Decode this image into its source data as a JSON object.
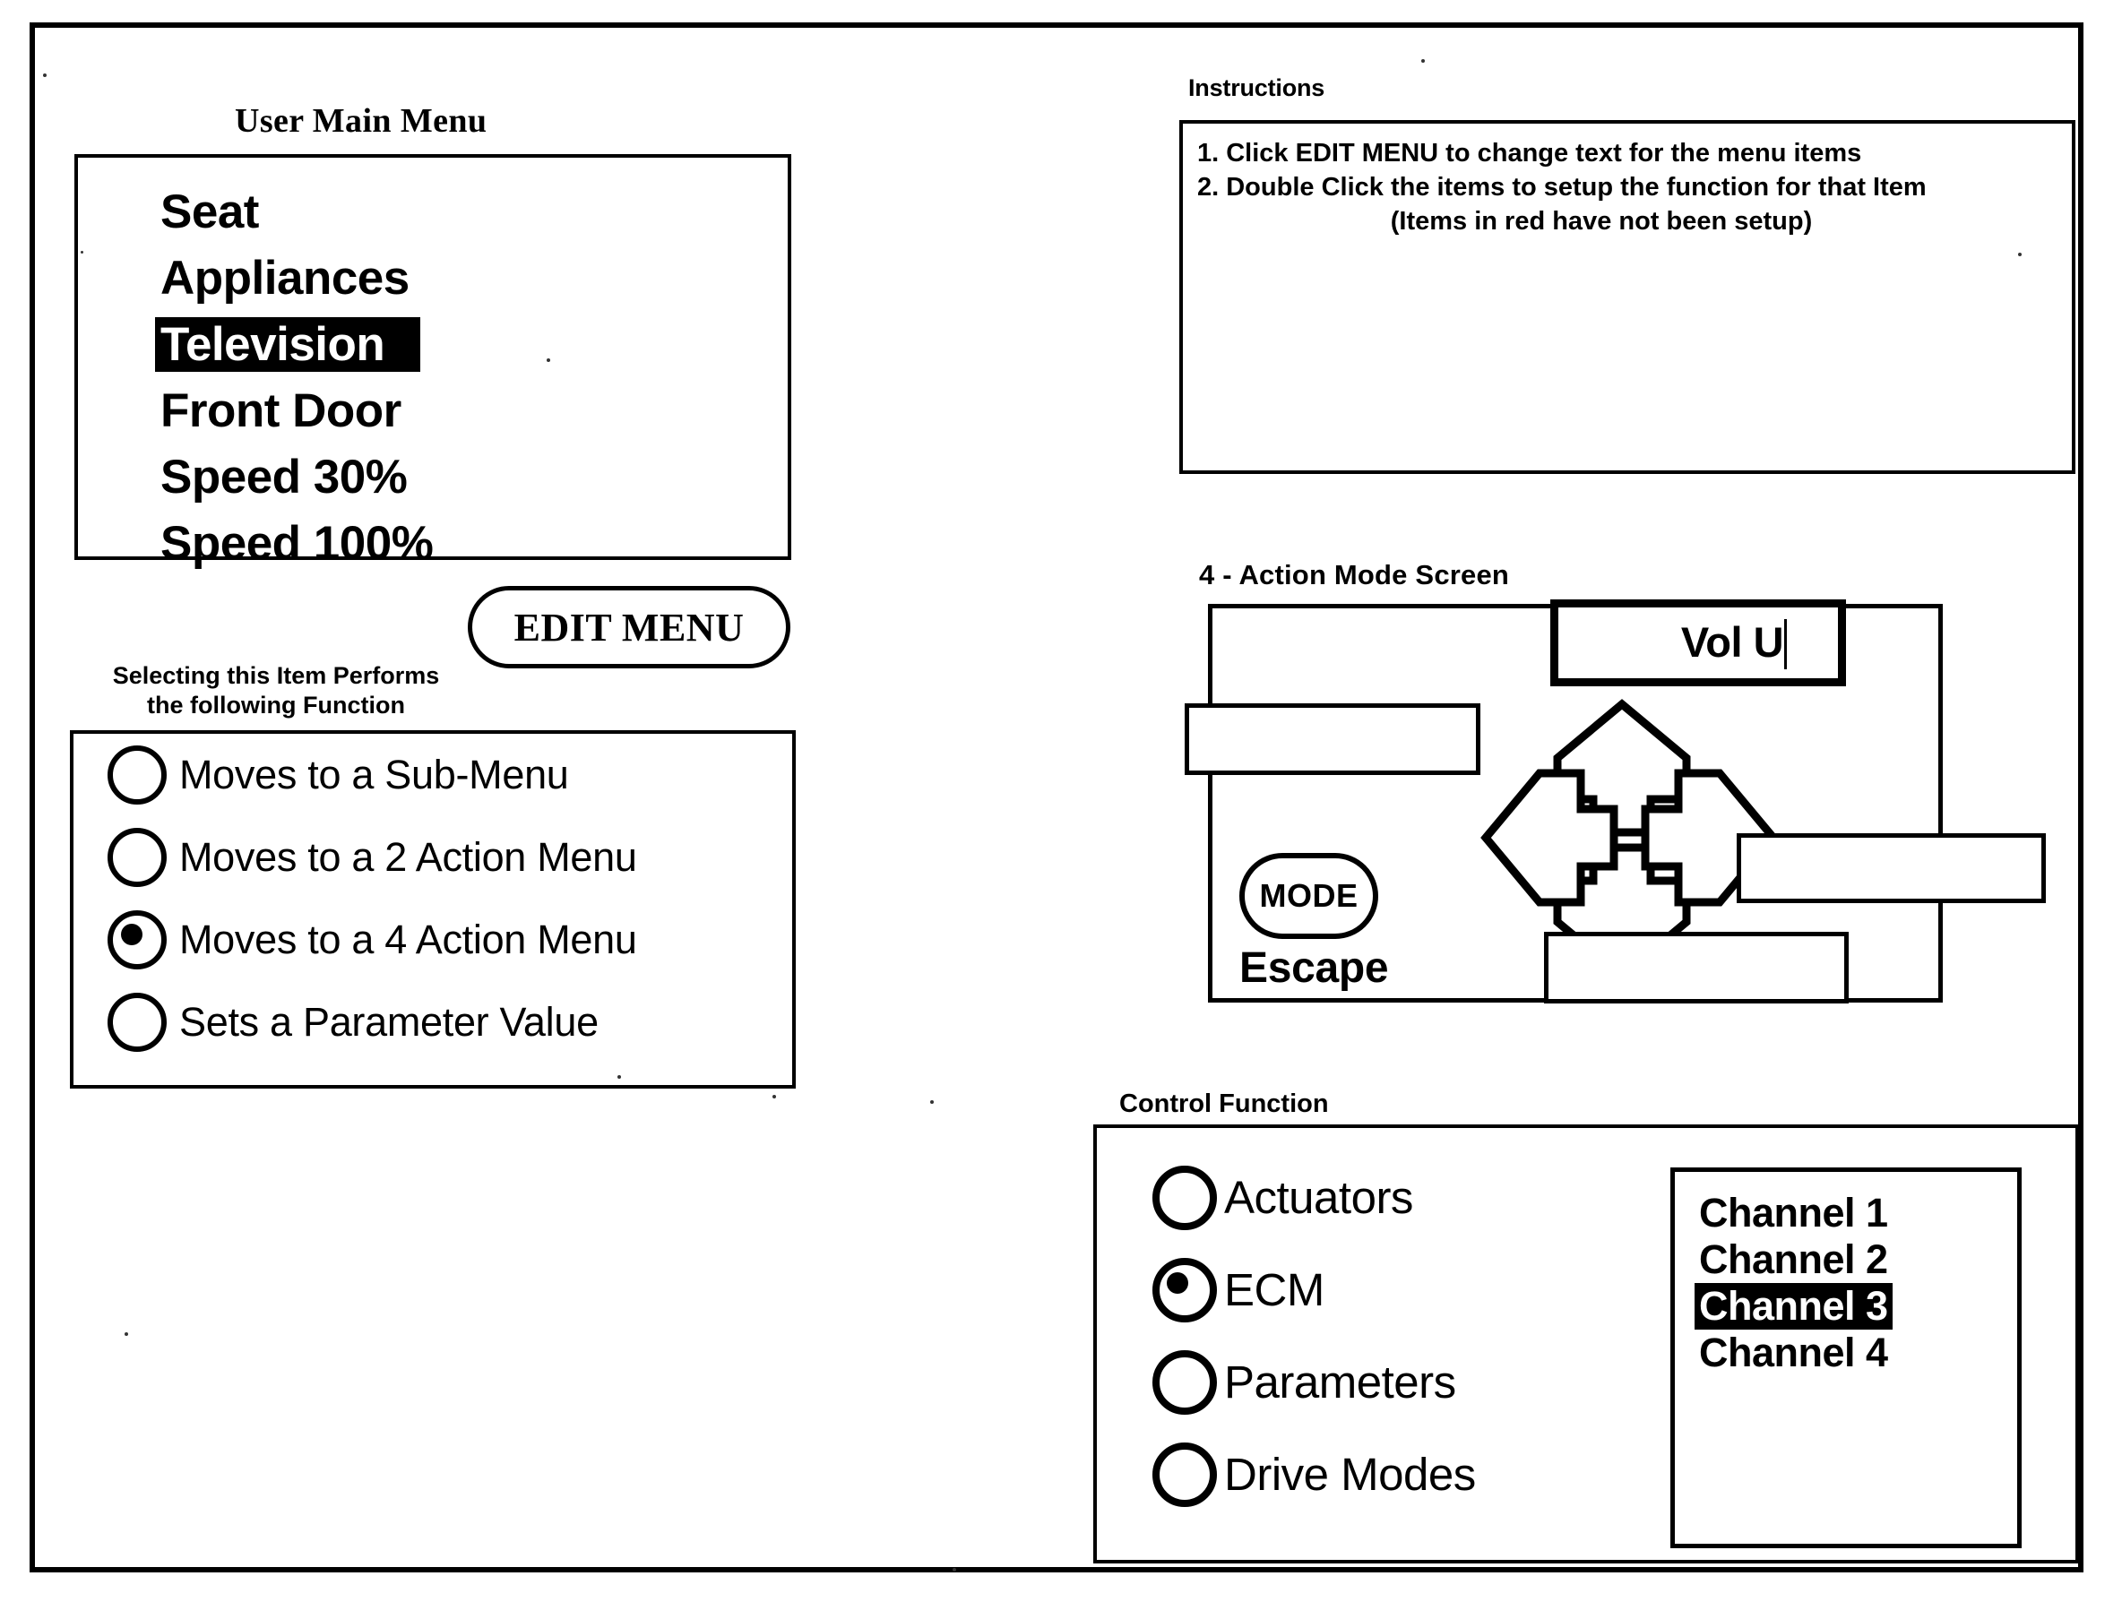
{
  "main_menu": {
    "title": "User Main Menu",
    "items": [
      {
        "label": "Seat",
        "selected": false
      },
      {
        "label": "Appliances",
        "selected": false
      },
      {
        "label": "Television",
        "selected": true
      },
      {
        "label": "Front Door",
        "selected": false
      },
      {
        "label": "Speed 30%",
        "selected": false
      },
      {
        "label": "Speed 100%",
        "selected": false
      }
    ]
  },
  "edit_menu_button": {
    "label": "EDIT MENU"
  },
  "function_group": {
    "caption_line1": "Selecting this Item Performs",
    "caption_line2": "the following Function",
    "options": [
      {
        "label": "Moves to a Sub-Menu",
        "selected": false
      },
      {
        "label": "Moves to a 2 Action Menu",
        "selected": false
      },
      {
        "label": "Moves to a 4 Action Menu",
        "selected": true
      },
      {
        "label": "Sets a Parameter Value",
        "selected": false
      }
    ]
  },
  "instructions": {
    "caption": "Instructions",
    "lines": [
      "1. Click EDIT MENU to change text for the menu items",
      "2.  Double Click the items to setup the function for that Item",
      "(Items in red have not been setup)"
    ]
  },
  "action_mode": {
    "caption": "4 - Action Mode Screen",
    "top_field": "Vol U",
    "left_field": "",
    "right_field": "",
    "bottom_field": "",
    "mode_button": "MODE",
    "escape_label": "Escape",
    "arrows": [
      "up-arrow",
      "down-arrow",
      "left-arrow",
      "right-arrow"
    ]
  },
  "control_function": {
    "caption": "Control Function",
    "options": [
      {
        "label": "Actuators",
        "selected": false
      },
      {
        "label": "ECM",
        "selected": true
      },
      {
        "label": "Parameters",
        "selected": false
      },
      {
        "label": "Drive Modes",
        "selected": false
      }
    ],
    "channels": [
      {
        "label": "Channel 1",
        "selected": false
      },
      {
        "label": "Channel 2",
        "selected": false
      },
      {
        "label": "Channel 3",
        "selected": true
      },
      {
        "label": "Channel 4",
        "selected": false
      }
    ]
  },
  "colors": {
    "ink": "#000000",
    "paper": "#ffffff",
    "highlight_bg": "#000000",
    "highlight_fg": "#ffffff"
  }
}
